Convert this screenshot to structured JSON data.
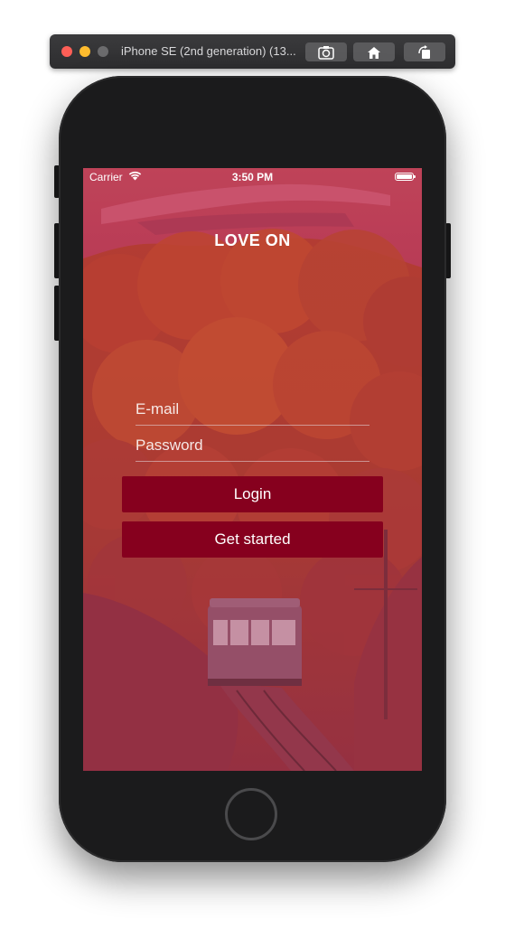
{
  "simulator": {
    "title": "iPhone SE (2nd generation) (13...",
    "buttons": [
      "screenshot-icon",
      "home-icon",
      "rotate-icon"
    ]
  },
  "status_bar": {
    "carrier": "Carrier",
    "time": "3:50 PM"
  },
  "app": {
    "title": "LOVE ON",
    "email_placeholder": "E-mail",
    "password_placeholder": "Password",
    "login_label": "Login",
    "get_started_label": "Get started"
  },
  "colors": {
    "button_bg": "#86001e",
    "overlay_tint": "#c0284a",
    "phone_body": "#1b1b1c"
  }
}
